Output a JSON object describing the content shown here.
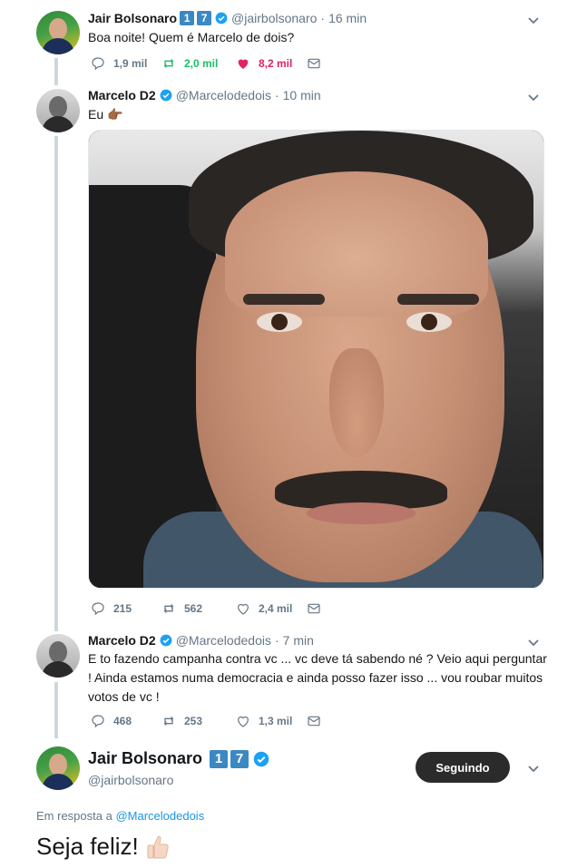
{
  "tweet1": {
    "name": "Jair Bolsonaro",
    "badges": [
      "1",
      "7"
    ],
    "handle": "@jairbolsonaro",
    "separator": "·",
    "time": "16 min",
    "text": "Boa noite! Quem é Marcelo de dois?",
    "replies": "1,9 mil",
    "retweets": "2,0 mil",
    "likes": "8,2 mil"
  },
  "tweet2": {
    "name": "Marcelo D2",
    "handle": "@Marcelodedois",
    "separator": "·",
    "time": "10 min",
    "text": "Eu 👉🏾",
    "replies": "215",
    "retweets": "562",
    "likes": "2,4 mil"
  },
  "tweet3": {
    "name": "Marcelo D2",
    "handle": "@Marcelodedois",
    "separator": "·",
    "time": "7 min",
    "text_line1": "E to fazendo campanha contra vc ... vc deve tá sabendo né ? Veio aqui perguntar",
    "text_line2": "! Ainda estamos numa democracia e ainda posso fazer isso ... vou roubar muitos",
    "text_line3": "votos de vc !",
    "replies": "468",
    "retweets": "253",
    "likes": "1,3 mil"
  },
  "main_tweet": {
    "name": "Jair Bolsonaro",
    "badges": [
      "1",
      "7"
    ],
    "handle": "@jairbolsonaro",
    "follow_label": "Seguindo",
    "reply_prefix": "Em resposta a",
    "reply_mention": "@Marcelodedois",
    "text": "Seja feliz!"
  },
  "colors": {
    "verified": "#1da1f2",
    "retweet_active": "#17bf63",
    "like_active": "#e0245e",
    "badge": "#3b88c3",
    "muted": "#657786"
  },
  "icons": [
    "reply-icon",
    "retweet-icon",
    "like-icon",
    "message-icon",
    "verified-icon",
    "chevron-down-icon",
    "thumbs-up-icon"
  ]
}
